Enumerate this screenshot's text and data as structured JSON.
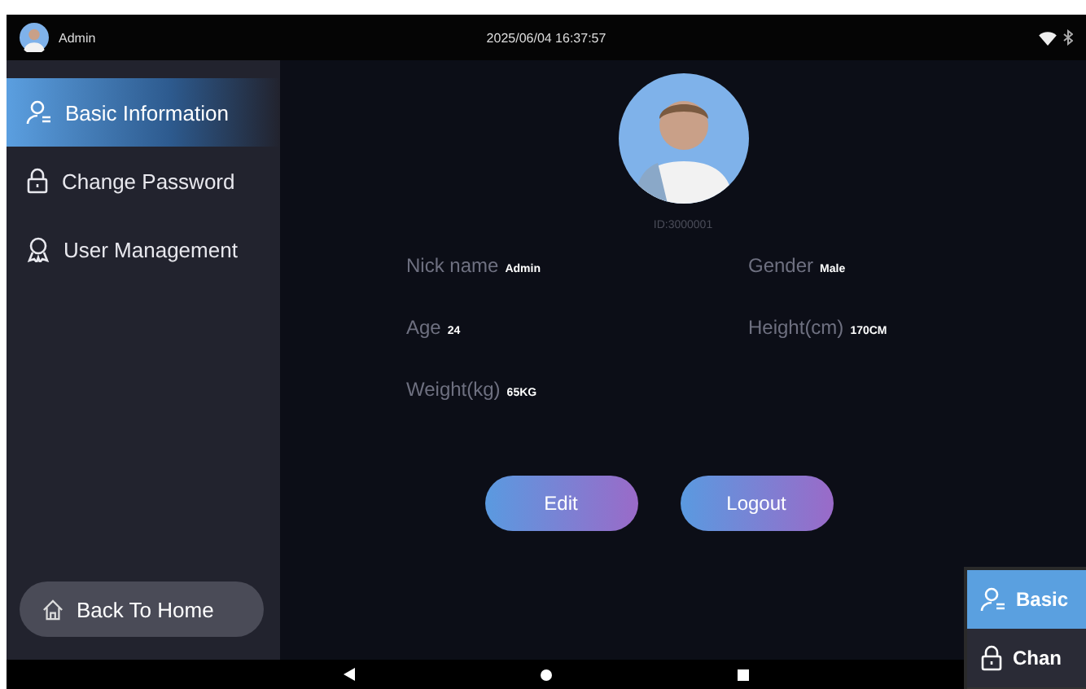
{
  "status_bar": {
    "user": "Admin",
    "datetime": "2025/06/04 16:37:57"
  },
  "sidebar": {
    "items": [
      {
        "label": "Basic Information",
        "selected": true
      },
      {
        "label": "Change Password",
        "selected": false
      },
      {
        "label": "User Management",
        "selected": false
      }
    ],
    "back_button": "Back To Home"
  },
  "profile": {
    "user_id": "ID:3000001",
    "fields": [
      {
        "label": "Nick name",
        "value": "Admin"
      },
      {
        "label": "Gender",
        "value": "Male"
      },
      {
        "label": "Age",
        "value": "24"
      },
      {
        "label": "Height(cm)",
        "value": "170CM"
      },
      {
        "label": "Weight(kg)",
        "value": "65KG"
      }
    ],
    "buttons": [
      "Edit",
      "Logout"
    ]
  },
  "recent_preview": {
    "items": [
      "Basic",
      "Chan"
    ]
  }
}
